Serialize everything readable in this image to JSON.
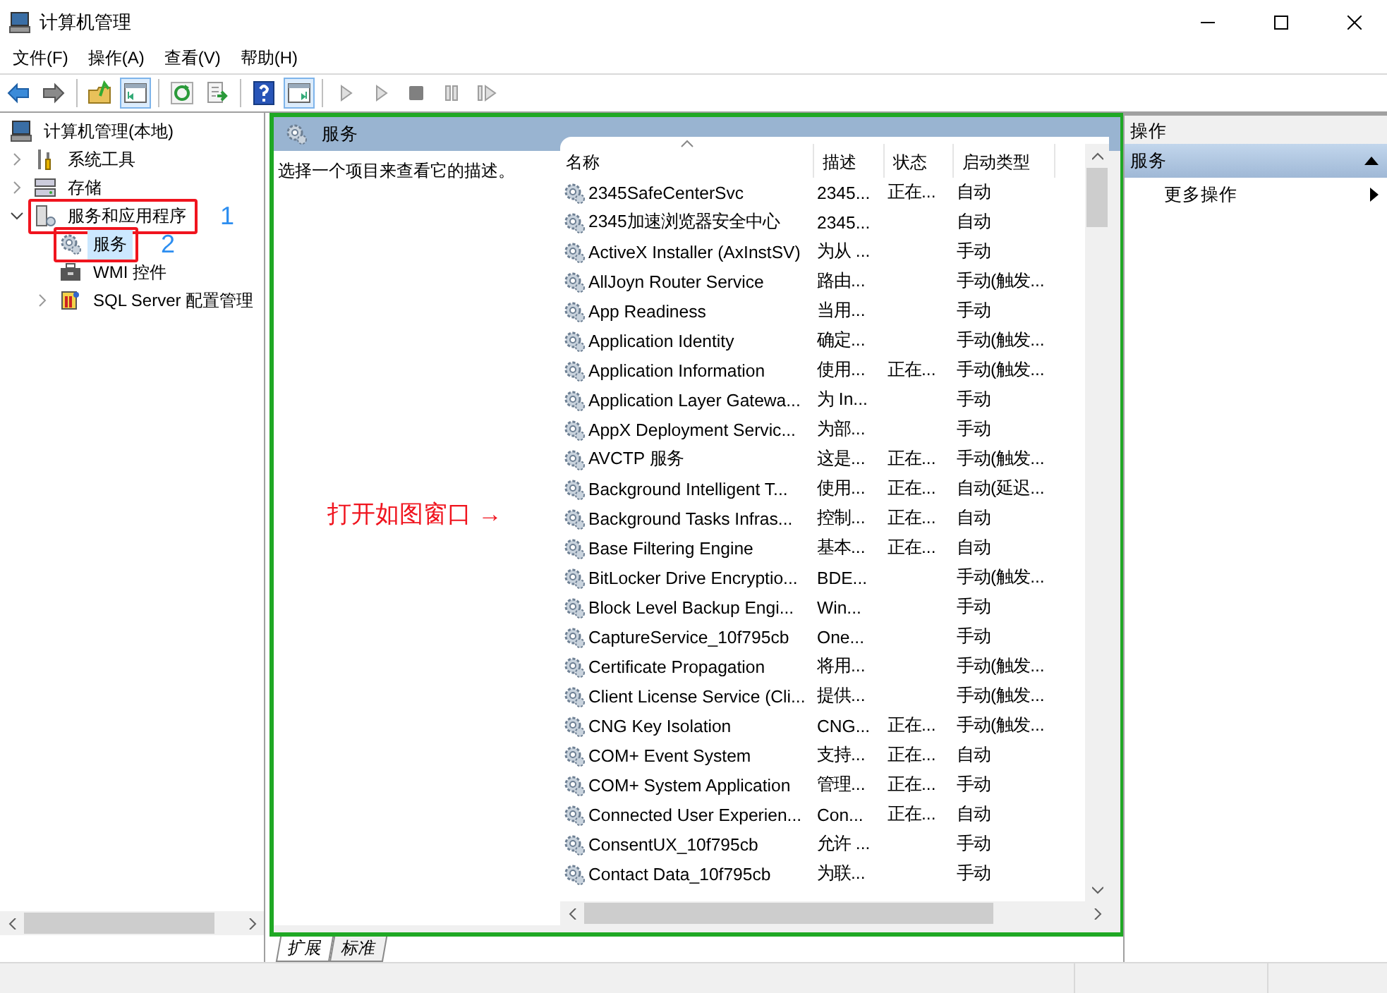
{
  "window": {
    "title": "计算机管理"
  },
  "menu": [
    "文件(F)",
    "操作(A)",
    "查看(V)",
    "帮助(H)"
  ],
  "toolbar": [
    {
      "kind": "back",
      "pressed": false,
      "disabled": false
    },
    {
      "kind": "forward",
      "pressed": false,
      "disabled": false
    },
    {
      "kind": "sep"
    },
    {
      "kind": "up",
      "pressed": false,
      "disabled": false
    },
    {
      "kind": "tree-pane",
      "pressed": true,
      "disabled": false
    },
    {
      "kind": "sep"
    },
    {
      "kind": "refresh",
      "pressed": false,
      "disabled": false
    },
    {
      "kind": "export",
      "pressed": false,
      "disabled": false
    },
    {
      "kind": "sep"
    },
    {
      "kind": "help",
      "pressed": false,
      "disabled": false
    },
    {
      "kind": "action-pane",
      "pressed": true,
      "disabled": false
    },
    {
      "kind": "sep"
    },
    {
      "kind": "play",
      "pressed": false,
      "disabled": true
    },
    {
      "kind": "play",
      "pressed": false,
      "disabled": true
    },
    {
      "kind": "stop",
      "pressed": false,
      "disabled": true
    },
    {
      "kind": "pause",
      "pressed": false,
      "disabled": true
    },
    {
      "kind": "resume",
      "pressed": false,
      "disabled": true
    }
  ],
  "tree": [
    {
      "label": "计算机管理(本地)",
      "kind": "computer",
      "selected": false,
      "marked": false,
      "children": [
        {
          "label": "系统工具",
          "kind": "tools",
          "expanded": false,
          "selected": false,
          "marked": false
        },
        {
          "label": "存储",
          "kind": "storage",
          "expanded": false,
          "selected": false,
          "marked": false
        },
        {
          "label": "服务和应用程序",
          "kind": "apps",
          "expanded": true,
          "selected": false,
          "marked": true,
          "step": "1",
          "children": [
            {
              "label": "服务",
              "kind": "service",
              "selected": true,
              "marked": true,
              "step": "2"
            },
            {
              "label": "WMI 控件",
              "kind": "wmi",
              "selected": false,
              "marked": false
            },
            {
              "label": "SQL Server 配置管理",
              "kind": "sql",
              "expanded": false,
              "selected": false,
              "marked": false
            }
          ]
        }
      ]
    }
  ],
  "center": {
    "highlighted": true,
    "title": "服务",
    "description": "选择一个项目来查看它的描述。",
    "callout": "打开如图窗口 →",
    "table": {
      "columns": [
        {
          "label": "名称",
          "sorted": true
        },
        {
          "label": "描述",
          "sorted": false
        },
        {
          "label": "状态",
          "sorted": false
        },
        {
          "label": "启动类型",
          "sorted": false
        }
      ],
      "rows": [
        {
          "name": "2345SafeCenterSvc",
          "description": "2345...",
          "status": "正在...",
          "startup": "自动"
        },
        {
          "name": "2345加速浏览器安全中心",
          "description": "2345...",
          "startup": "自动"
        },
        {
          "name": "ActiveX Installer (AxInstSV)",
          "description": "为从 ...",
          "startup": "手动"
        },
        {
          "name": "AllJoyn Router Service",
          "description": "路由...",
          "startup": "手动(触发..."
        },
        {
          "name": "App Readiness",
          "description": "当用...",
          "startup": "手动"
        },
        {
          "name": "Application Identity",
          "description": "确定...",
          "startup": "手动(触发..."
        },
        {
          "name": "Application Information",
          "description": "使用...",
          "status": "正在...",
          "startup": "手动(触发..."
        },
        {
          "name": "Application Layer Gatewa...",
          "description": "为 In...",
          "startup": "手动"
        },
        {
          "name": "AppX Deployment Servic...",
          "description": "为部...",
          "startup": "手动"
        },
        {
          "name": "AVCTP 服务",
          "description": "这是...",
          "status": "正在...",
          "startup": "手动(触发..."
        },
        {
          "name": "Background Intelligent T...",
          "description": "使用...",
          "status": "正在...",
          "startup": "自动(延迟..."
        },
        {
          "name": "Background Tasks Infras...",
          "description": "控制...",
          "status": "正在...",
          "startup": "自动"
        },
        {
          "name": "Base Filtering Engine",
          "description": "基本...",
          "status": "正在...",
          "startup": "自动"
        },
        {
          "name": "BitLocker Drive Encryptio...",
          "description": "BDE...",
          "startup": "手动(触发..."
        },
        {
          "name": "Block Level Backup Engi...",
          "description": "Win...",
          "startup": "手动"
        },
        {
          "name": "CaptureService_10f795cb",
          "description": "One...",
          "startup": "手动"
        },
        {
          "name": "Certificate Propagation",
          "description": "将用...",
          "startup": "手动(触发..."
        },
        {
          "name": "Client License Service (Cli...",
          "description": "提供...",
          "startup": "手动(触发..."
        },
        {
          "name": "CNG Key Isolation",
          "description": "CNG...",
          "status": "正在...",
          "startup": "手动(触发..."
        },
        {
          "name": "COM+ Event System",
          "description": "支持...",
          "status": "正在...",
          "startup": "自动"
        },
        {
          "name": "COM+ System Application",
          "description": "管理...",
          "status": "正在...",
          "startup": "手动"
        },
        {
          "name": "Connected User Experien...",
          "description": "Con...",
          "status": "正在...",
          "startup": "自动"
        },
        {
          "name": "ConsentUX_10f795cb",
          "description": "允许 ...",
          "startup": "手动"
        },
        {
          "name": "Contact Data_10f795cb",
          "description": "为联...",
          "startup": "手动"
        }
      ]
    },
    "tabs": [
      {
        "label": "扩展",
        "selected": true
      },
      {
        "label": "标准",
        "selected": false
      }
    ]
  },
  "actions": {
    "title": "操作",
    "section": {
      "label": "服务",
      "expanded": true
    },
    "items": [
      {
        "label": "更多操作"
      }
    ]
  }
}
